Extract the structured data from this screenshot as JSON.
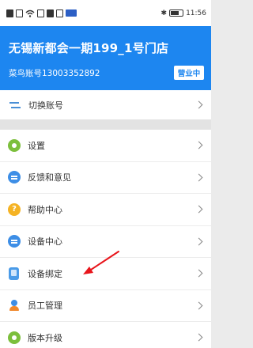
{
  "status_bar": {
    "time": "11:56",
    "icons": [
      "notification-icon",
      "signal-icon",
      "wifi-icon",
      "app-icon",
      "app-icon",
      "app-icon",
      "app-badge-icon",
      "bluetooth-icon",
      "battery-icon"
    ]
  },
  "header": {
    "store_name": "无锡新都会一期199_1号门店",
    "account_label": "菜鸟账号13003352892",
    "status_button": "营业中",
    "accent_color": "#1d86f0"
  },
  "switch_account": {
    "label": "切换账号",
    "icon": "swap-icon"
  },
  "menu": {
    "items": [
      {
        "label": "设置",
        "icon": "gear-icon"
      },
      {
        "label": "反馈和意见",
        "icon": "chat-icon"
      },
      {
        "label": "帮助中心",
        "icon": "help-icon"
      },
      {
        "label": "设备中心",
        "icon": "chat-icon"
      },
      {
        "label": "设备绑定",
        "icon": "device-icon"
      },
      {
        "label": "员工管理",
        "icon": "user-icon"
      },
      {
        "label": "版本升级",
        "icon": "gear-icon"
      }
    ]
  },
  "annotation": {
    "arrow_color": "#e8151b",
    "target": "设备绑定"
  }
}
